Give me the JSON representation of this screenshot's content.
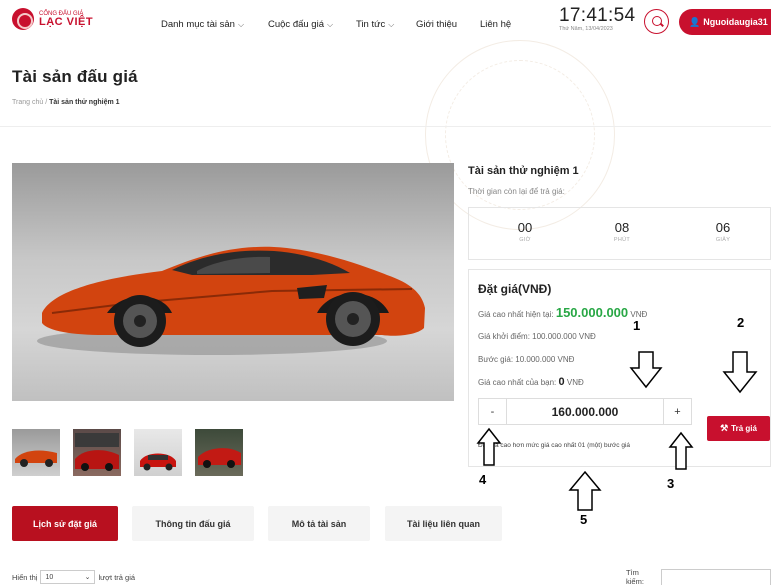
{
  "brand": {
    "small": "CỔNG ĐẤU GIÁ",
    "big": "LẠC VIỆT",
    "color": "#c8102e"
  },
  "nav": [
    {
      "label": "Danh mục tài sản",
      "dropdown": true
    },
    {
      "label": "Cuộc đấu giá",
      "dropdown": true
    },
    {
      "label": "Tin tức",
      "dropdown": true
    },
    {
      "label": "Giới thiệu",
      "dropdown": false
    },
    {
      "label": "Liên hệ",
      "dropdown": false
    }
  ],
  "clock": {
    "time": "17:41:54",
    "date": "Thứ Năm, 13/04/2023"
  },
  "user": {
    "name": "Nguoidaugia31",
    "icon": "user-icon"
  },
  "page": {
    "title": "Tài sản đấu giá",
    "breadcrumb_home": "Trang chủ",
    "breadcrumb_sep": " / ",
    "breadcrumb_current": "Tài sản thử nghiệm 1"
  },
  "asset": {
    "name": "Tài sản thử nghiệm 1",
    "time_label": "Thời gian còn lại để trả giá:",
    "countdown": [
      {
        "value": "00",
        "label": "GIỜ"
      },
      {
        "value": "08",
        "label": "PHÚT"
      },
      {
        "value": "06",
        "label": "GIÂY"
      }
    ]
  },
  "bid": {
    "title": "Đặt giá(VNĐ)",
    "current_label": "Giá cao nhất hiện tại:",
    "current_value": "150.000.000",
    "currency": "VNĐ",
    "start_line": "Giá khởi điểm: 100.000.000 VNĐ",
    "step_line": "Bước giá: 10.000.000 VNĐ",
    "mine_label": "Giá cao nhất của bạn:",
    "mine_value": "0",
    "minus": "-",
    "plus": "+",
    "input_value": "160.000.000",
    "note": "Đặt giá cao hơn mức giá cao nhất 01 (một) bước giá",
    "button": "Trả giá",
    "button_icon": "hammer-icon",
    "accent_green": "#28a745"
  },
  "annotations": [
    "1",
    "2",
    "3",
    "4",
    "5"
  ],
  "tabs": [
    {
      "label": "Lịch sử đặt giá",
      "active": true
    },
    {
      "label": "Thông tin đấu giá",
      "active": false
    },
    {
      "label": "Mô tả tài sản",
      "active": false
    },
    {
      "label": "Tài liệu liên quan",
      "active": false
    }
  ],
  "table_controls": {
    "show_prefix": "Hiển thị",
    "show_value": "10",
    "show_suffix": "lượt trả giá",
    "search_label": "Tìm kiếm:"
  }
}
